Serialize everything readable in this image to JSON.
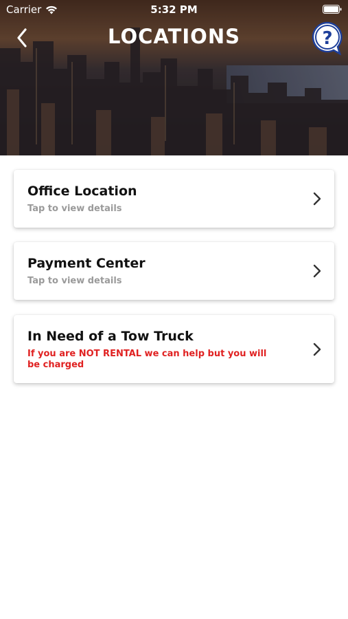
{
  "status_bar": {
    "carrier": "Carrier",
    "time": "5:32 PM"
  },
  "nav": {
    "title": "LOCATIONS",
    "back_icon": "chevron-left-icon",
    "help_icon": "question-bubble-icon"
  },
  "cards": [
    {
      "title": "Office Location",
      "subtitle": "Tap to view details",
      "subtitle_style": "muted"
    },
    {
      "title": "Payment Center",
      "subtitle": "Tap to view details",
      "subtitle_style": "muted"
    },
    {
      "title": "In Need of a Tow Truck",
      "subtitle": "If you are NOT RENTAL we can help but you will be charged",
      "subtitle_style": "warning"
    }
  ],
  "colors": {
    "warning_text": "#e02121",
    "muted_text": "#9a9a9a",
    "title_text": "#111111",
    "help_icon_blue": "#1e3f9a"
  }
}
